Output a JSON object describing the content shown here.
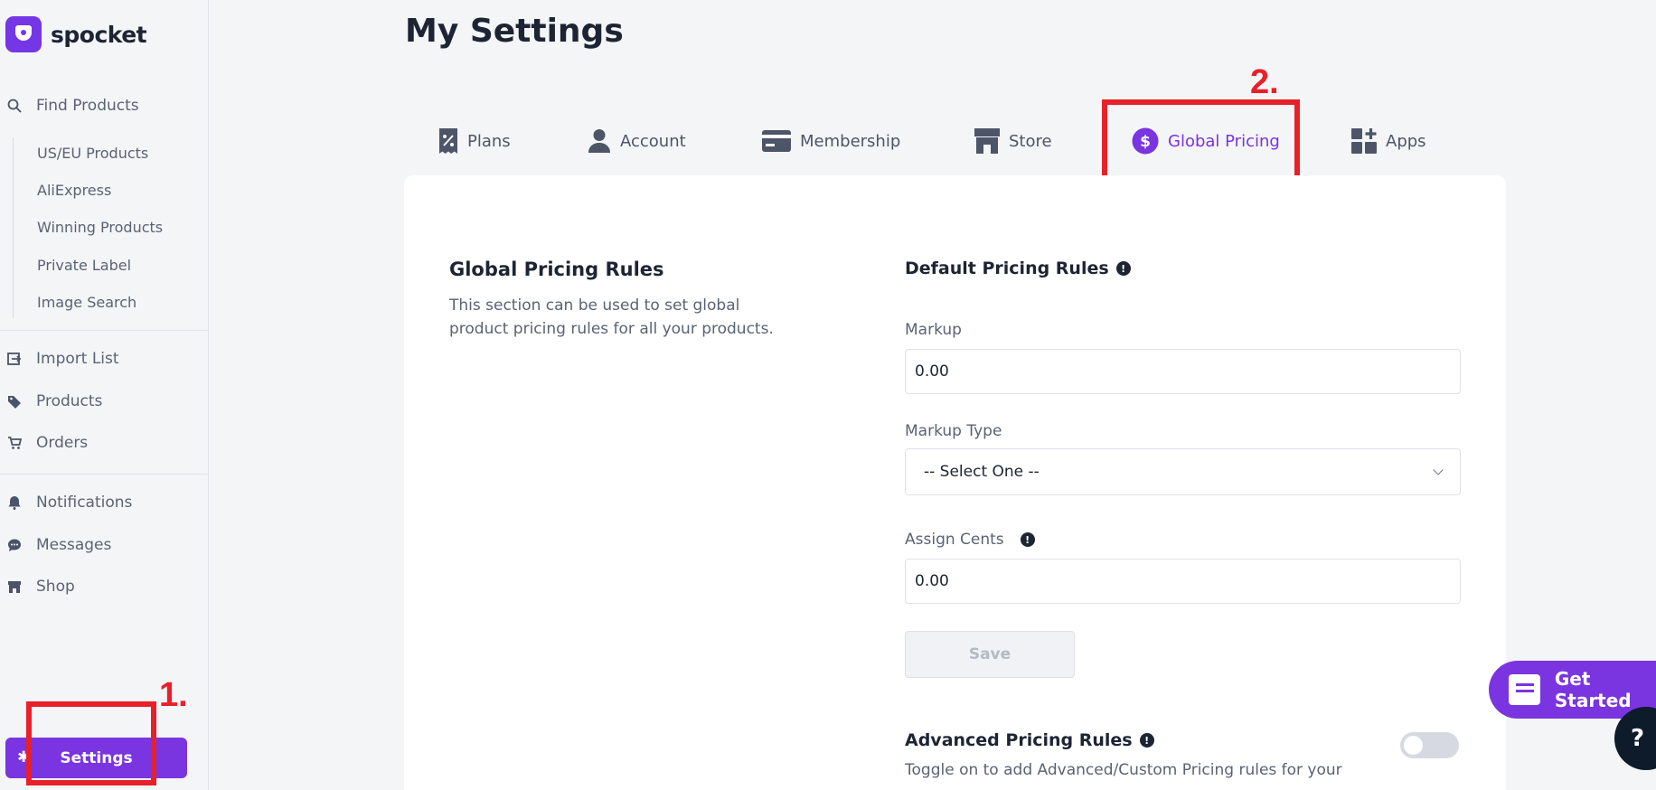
{
  "brand": {
    "name": "spocket"
  },
  "sidebar": {
    "find_products": {
      "label": "Find Products",
      "icon": "search-icon"
    },
    "sub_items": [
      {
        "label": "US/EU Products"
      },
      {
        "label": "AliExpress"
      },
      {
        "label": "Winning Products"
      },
      {
        "label": "Private Label"
      },
      {
        "label": "Image Search"
      }
    ],
    "items": [
      {
        "label": "Import List",
        "icon": "import-icon"
      },
      {
        "label": "Products",
        "icon": "tag-icon"
      },
      {
        "label": "Orders",
        "icon": "cart-icon"
      },
      {
        "label": "Notifications",
        "icon": "bell-icon"
      },
      {
        "label": "Messages",
        "icon": "chat-icon"
      },
      {
        "label": "Shop",
        "icon": "store-icon"
      }
    ],
    "settings_label": "Settings"
  },
  "annotations": {
    "step1": "1.",
    "step2": "2."
  },
  "page": {
    "title": "My Settings"
  },
  "tabs": [
    {
      "label": "Plans",
      "icon": "receipt-percent-icon"
    },
    {
      "label": "Account",
      "icon": "user-icon"
    },
    {
      "label": "Membership",
      "icon": "credit-card-icon"
    },
    {
      "label": "Store",
      "icon": "store-icon"
    },
    {
      "label": "Global Pricing",
      "icon": "dollar-circle-icon",
      "active": true
    },
    {
      "label": "Apps",
      "icon": "apps-icon"
    }
  ],
  "pricing": {
    "section_title": "Global Pricing Rules",
    "section_desc": "This section can be used to set global product pricing rules for all your products.",
    "default_title": "Default Pricing Rules",
    "markup_label": "Markup",
    "markup_value": "0.00",
    "markup_type_label": "Markup Type",
    "markup_type_value": "-- Select One --",
    "assign_cents_label": "Assign Cents",
    "assign_cents_value": "0.00",
    "save_label": "Save",
    "advanced_title": "Advanced Pricing Rules",
    "advanced_desc": "Toggle on to add Advanced/Custom Pricing rules for your",
    "advanced_enabled": false
  },
  "widgets": {
    "get_started": "Get Started",
    "help": "?"
  },
  "colors": {
    "accent": "#7a34e0",
    "annotation": "#e8202a",
    "dark": "#1d2433"
  }
}
